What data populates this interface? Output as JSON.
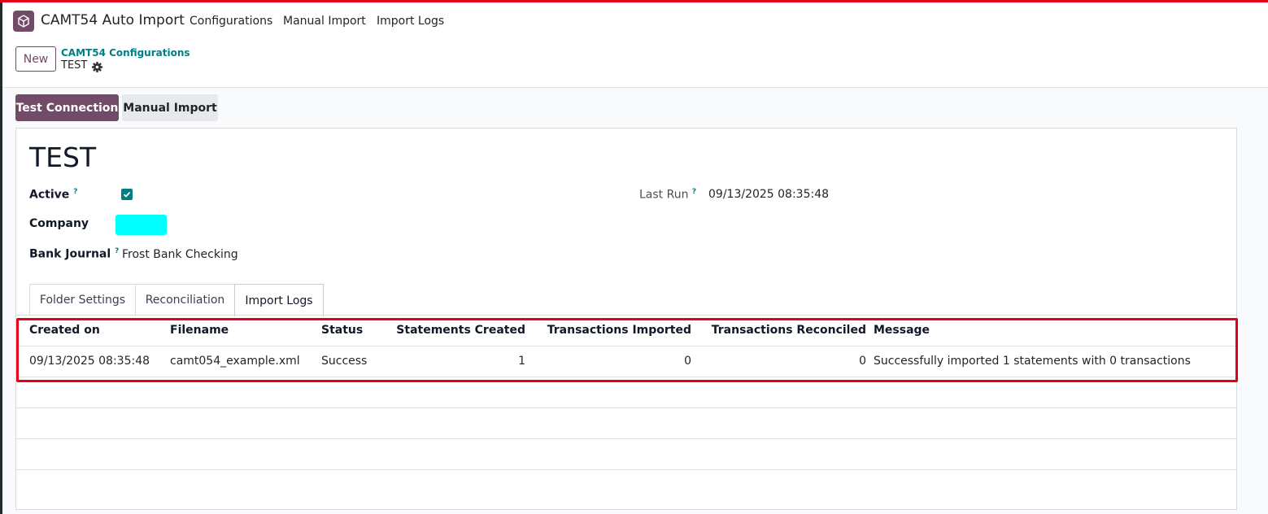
{
  "navbar": {
    "app_name": "CAMT54 Auto Import",
    "menu": [
      "Configurations",
      "Manual Import",
      "Import Logs"
    ]
  },
  "control_panel": {
    "new_label": "New",
    "breadcrumb_parent": "CAMT54 Configurations",
    "breadcrumb_current": "TEST"
  },
  "actions": {
    "test_connection": "Test Connection",
    "manual_import": "Manual Import"
  },
  "record": {
    "title": "TEST",
    "fields": {
      "active_label": "Active",
      "active_help": "?",
      "active_checked": true,
      "company_label": "Company",
      "bank_journal_label": "Bank Journal",
      "bank_journal_help": "?",
      "bank_journal_value": "Frost Bank Checking",
      "last_run_label": "Last Run",
      "last_run_help": "?",
      "last_run_value": "09/13/2025 08:35:48"
    }
  },
  "tabs": [
    "Folder Settings",
    "Reconciliation",
    "Import Logs"
  ],
  "active_tab": "Import Logs",
  "logs_table": {
    "columns": [
      "Created on",
      "Filename",
      "Status",
      "Statements Created",
      "Transactions Imported",
      "Transactions Reconciled",
      "Message"
    ],
    "rows": [
      [
        "09/13/2025 08:35:48",
        "camt054_example.xml",
        "Success",
        "1",
        "0",
        "0",
        "Successfully imported 1 statements with 0 transactions"
      ]
    ]
  },
  "colors": {
    "brand": "#714b67",
    "accent": "#017e84",
    "highlight": "#e4001b",
    "redacted": "#00ffff"
  },
  "icons": {
    "app": "cube-icon",
    "gear": "gear-icon",
    "check": "check-icon"
  }
}
